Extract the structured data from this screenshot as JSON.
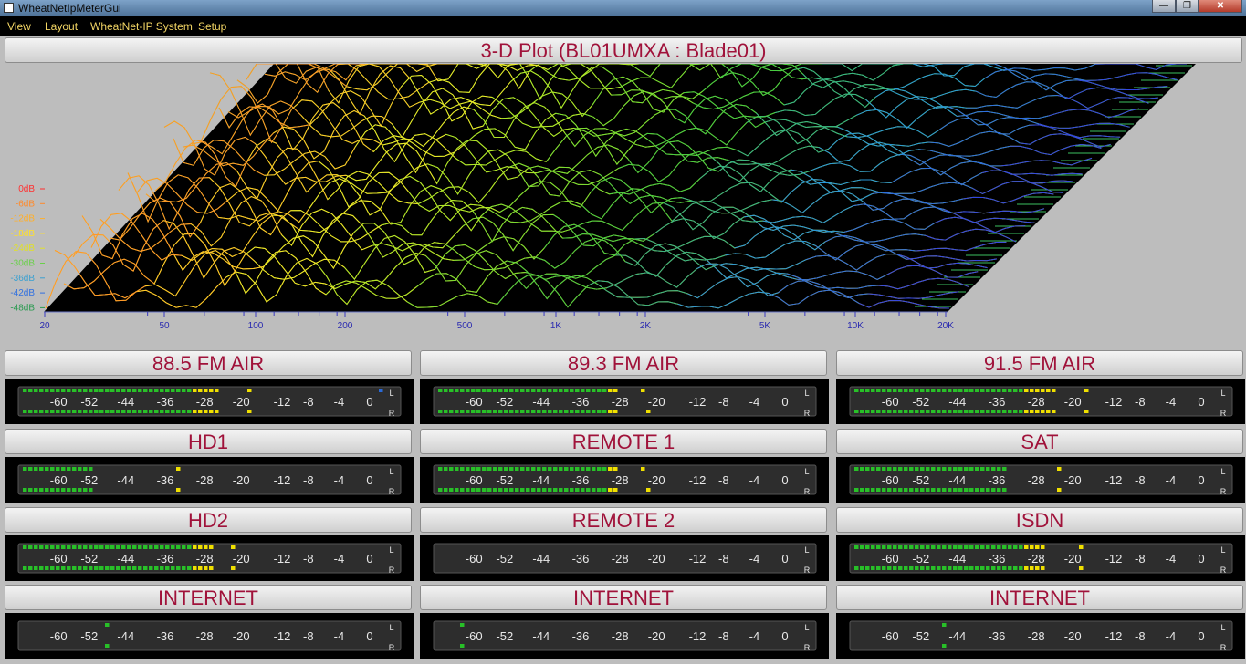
{
  "window": {
    "title": "WheatNetIpMeterGui",
    "minimize_glyph": "—",
    "maximize_glyph": "❐",
    "close_glyph": "✕"
  },
  "menu": [
    "View",
    "Layout",
    "WheatNet-IP System",
    "Setup"
  ],
  "plot": {
    "title": "3-D Plot  (BL01UMXA : Blade01)",
    "db_labels": [
      "0dB",
      "-6dB",
      "-12dB",
      "-18dB",
      "-24dB",
      "-30dB",
      "-36dB",
      "-42dB",
      "-48dB"
    ],
    "db_colors": [
      "#ff3030",
      "#ff8a2a",
      "#ffaf2a",
      "#ffe02a",
      "#e0e02a",
      "#6ad04a",
      "#3aa0d0",
      "#3070e0",
      "#2a9a50"
    ],
    "freq_labels": [
      "20",
      "50",
      "100",
      "200",
      "500",
      "1K",
      "2K",
      "5K",
      "10K",
      "20K"
    ]
  },
  "meter_scale": [
    "-60",
    "-52",
    "-44",
    "-36",
    "-28",
    "-20",
    "-12",
    "-8",
    "-4",
    "0"
  ],
  "channel_labels": [
    "L",
    "R"
  ],
  "colors": {
    "accent": "#a0123a",
    "meter_green": "#28c028",
    "meter_yellow": "#f0e000",
    "meter_red": "#e02020",
    "meter_blue": "#2a6ad8"
  },
  "panels": [
    {
      "name": "88.5  FM AIR",
      "left": {
        "segs": 36,
        "peak": 5,
        "over": "blue"
      },
      "right": {
        "segs": 36,
        "peak": 5,
        "over": ""
      }
    },
    {
      "name": "89.3 FM AIR",
      "left": {
        "segs": 33,
        "peak": 4,
        "over": ""
      },
      "right": {
        "segs": 33,
        "peak": 5,
        "over": ""
      }
    },
    {
      "name": "91.5 FM AIR",
      "left": {
        "segs": 37,
        "peak": 5,
        "over": ""
      },
      "right": {
        "segs": 37,
        "peak": 5,
        "over": ""
      }
    },
    {
      "name": "HD1",
      "left": {
        "segs": 13,
        "peak": 15,
        "over": ""
      },
      "right": {
        "segs": 13,
        "peak": 15,
        "over": ""
      }
    },
    {
      "name": "REMOTE 1",
      "left": {
        "segs": 33,
        "peak": 4,
        "over": ""
      },
      "right": {
        "segs": 33,
        "peak": 5,
        "over": ""
      }
    },
    {
      "name": "SAT",
      "left": {
        "segs": 28,
        "peak": 9,
        "over": ""
      },
      "right": {
        "segs": 28,
        "peak": 9,
        "over": ""
      }
    },
    {
      "name": "HD2",
      "left": {
        "segs": 35,
        "peak": 3,
        "over": ""
      },
      "right": {
        "segs": 35,
        "peak": 3,
        "over": ""
      }
    },
    {
      "name": "REMOTE 2",
      "left": {
        "segs": 0,
        "peak": 0,
        "over": ""
      },
      "right": {
        "segs": 0,
        "peak": 0,
        "over": ""
      }
    },
    {
      "name": "ISDN",
      "left": {
        "segs": 35,
        "peak": 6,
        "over": ""
      },
      "right": {
        "segs": 35,
        "peak": 6,
        "over": ""
      }
    },
    {
      "name": "INTERNET",
      "left": {
        "segs": 0,
        "peak": 15,
        "over": ""
      },
      "right": {
        "segs": 0,
        "peak": 15,
        "over": ""
      }
    },
    {
      "name": "INTERNET",
      "left": {
        "segs": 0,
        "peak": 4,
        "over": ""
      },
      "right": {
        "segs": 0,
        "peak": 4,
        "over": ""
      }
    },
    {
      "name": "INTERNET",
      "left": {
        "segs": 0,
        "peak": 16,
        "over": ""
      },
      "right": {
        "segs": 0,
        "peak": 16,
        "over": ""
      }
    }
  ]
}
